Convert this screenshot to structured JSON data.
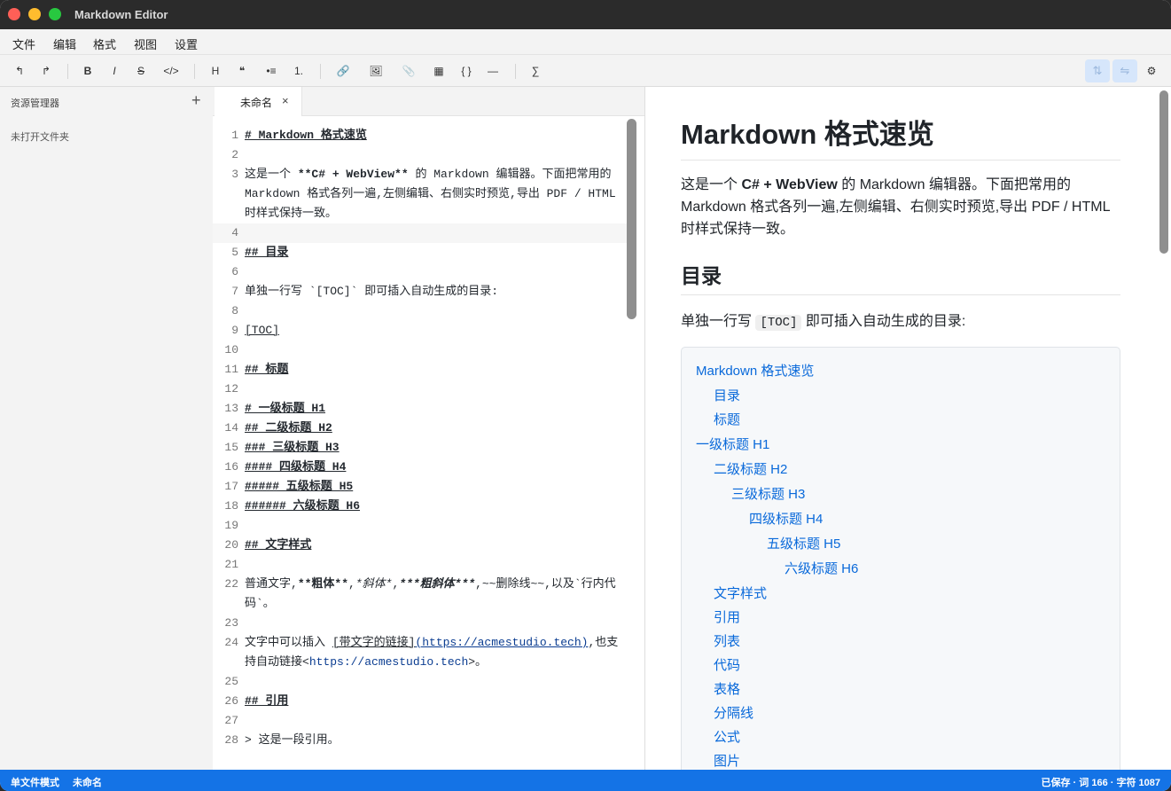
{
  "window": {
    "title": "Markdown Editor"
  },
  "menu": [
    "文件",
    "编辑",
    "格式",
    "视图",
    "设置"
  ],
  "toolbar": {
    "undo": "↰",
    "redo": "↱",
    "bold": "B",
    "italic": "I",
    "strike": "S",
    "code": "</>",
    "heading": "H",
    "quote": "❝",
    "ul": "•≡",
    "ol": "1.",
    "link": "🔗",
    "image": "🖼",
    "attach": "📎",
    "table": "▦",
    "codeblock": "{ }",
    "hr": "—",
    "math": "∑",
    "toggle_sync": "⇅",
    "toggle_swap": "⇋",
    "settings": "⚙"
  },
  "sidebar": {
    "title": "资源管理器",
    "add": "+",
    "empty": "未打开文件夹"
  },
  "editor": {
    "tab": {
      "label": "未命名",
      "close": "×"
    },
    "lines": [
      {
        "n": "1",
        "t": "# Markdown 格式速览",
        "k": "h"
      },
      {
        "n": "2",
        "t": "",
        "k": ""
      },
      {
        "n": "3",
        "t": "这是一个 **C# + WebView** 的 Markdown 编辑器。下面把常用的 Markdown 格式各列一遍,左侧编辑、右侧实时预览,导出 PDF / HTML 时样式保持一致。",
        "k": "p3"
      },
      {
        "n": "4",
        "t": "",
        "k": "active"
      },
      {
        "n": "5",
        "t": "## 目录",
        "k": "h"
      },
      {
        "n": "6",
        "t": "",
        "k": ""
      },
      {
        "n": "7",
        "t": "单独一行写 `[TOC]` 即可插入自动生成的目录:",
        "k": ""
      },
      {
        "n": "8",
        "t": "",
        "k": ""
      },
      {
        "n": "9",
        "t": "[TOC]",
        "k": "u"
      },
      {
        "n": "10",
        "t": "",
        "k": ""
      },
      {
        "n": "11",
        "t": "## 标题",
        "k": "h"
      },
      {
        "n": "12",
        "t": "",
        "k": ""
      },
      {
        "n": "13",
        "t": "# 一级标题 H1",
        "k": "h"
      },
      {
        "n": "14",
        "t": "## 二级标题 H2",
        "k": "h"
      },
      {
        "n": "15",
        "t": "### 三级标题 H3",
        "k": "h"
      },
      {
        "n": "16",
        "t": "#### 四级标题 H4",
        "k": "h"
      },
      {
        "n": "17",
        "t": "##### 五级标题 H5",
        "k": "h"
      },
      {
        "n": "18",
        "t": "###### 六级标题 H6",
        "k": "h"
      },
      {
        "n": "19",
        "t": "",
        "k": ""
      },
      {
        "n": "20",
        "t": "## 文字样式",
        "k": "h"
      },
      {
        "n": "21",
        "t": "",
        "k": ""
      },
      {
        "n": "22",
        "t": "普通文字,**粗体**,*斜体*,***粗斜体***,~~删除线~~,以及`行内代码`。",
        "k": ""
      },
      {
        "n": "23",
        "t": "",
        "k": ""
      },
      {
        "n": "24",
        "t": "文字中可以插入 [带文字的链接](https://acmestudio.tech),也支持自动链接<https://acmestudio.tech>。",
        "k": ""
      },
      {
        "n": "25",
        "t": "",
        "k": ""
      },
      {
        "n": "26",
        "t": "## 引用",
        "k": "h"
      },
      {
        "n": "27",
        "t": "",
        "k": ""
      },
      {
        "n": "28",
        "t": "> 这是一段引用。",
        "k": ""
      }
    ],
    "line3": {
      "a": "这是一个 ",
      "b": "**C# + WebView**",
      "c": " 的 Markdown 编辑器。下面把常用的 Markdown 格式各列一遍,左侧编辑、右侧实时预览,导出 PDF / HTML 时样式保持一致。"
    },
    "line22": {
      "a": "普通文字,",
      "b": "**粗体**",
      "c": ",",
      "d": "*斜体*",
      "e": ",",
      "f": "***粗斜体***",
      "g": ",~~删除线~~,以及`行内代码`。"
    },
    "line24": {
      "a": "文字中可以插入 ",
      "b": "[带文字的链接]",
      "c": "(https://acmestudio.tech)",
      "d": ",也支持自动链接<",
      "e": "https://acmestudio.tech",
      "f": ">。"
    }
  },
  "preview": {
    "h1": "Markdown 格式速览",
    "p1": {
      "a": "这是一个 ",
      "b": "C# + WebView",
      "c": " 的 Markdown 编辑器。下面把常用的 Markdown 格式各列一遍,左侧编辑、右侧实时预览,导出 PDF / HTML 时样式保持一致。"
    },
    "h2": "目录",
    "p2": {
      "a": "单独一行写 ",
      "code": "[TOC]",
      "b": " 即可插入自动生成的目录:"
    },
    "toc": [
      "Markdown 格式速览",
      "目录",
      "标题",
      "一级标题 H1",
      "二级标题 H2",
      "三级标题 H3",
      "四级标题 H4",
      "五级标题 H5",
      "六级标题 H6",
      "文字样式",
      "引用",
      "列表",
      "代码",
      "表格",
      "分隔线",
      "公式",
      "图片"
    ]
  },
  "status": {
    "mode": "单文件模式",
    "file": "未命名",
    "right": "已保存 · 词 166 · 字符 1087"
  }
}
